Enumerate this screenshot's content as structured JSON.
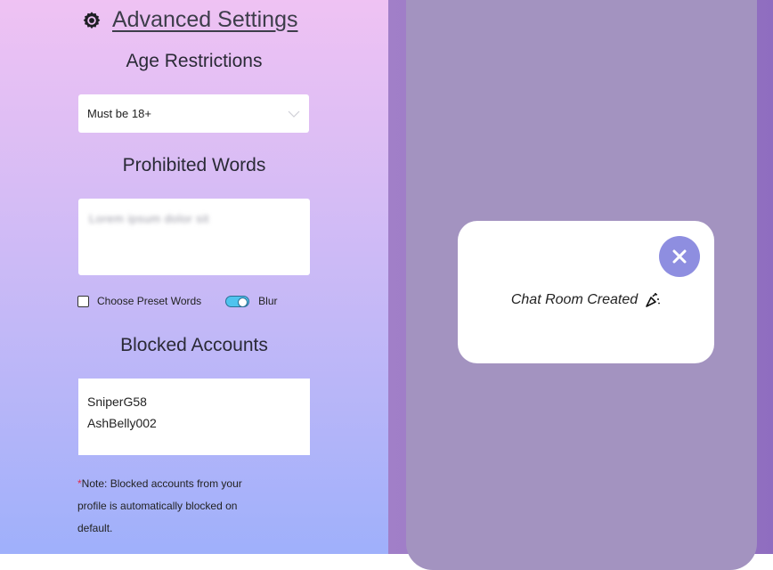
{
  "header": {
    "title": "Advanced Settings",
    "icon": "gear-icon"
  },
  "age": {
    "heading": "Age Restrictions",
    "selected": "Must be 18+"
  },
  "prohibited": {
    "heading": "Prohibited Words",
    "placeholder": "Lorem ipsum dolor sit",
    "preset_label": "Choose Preset Words",
    "blur_label": "Blur",
    "preset_checked": false,
    "blur_on": true
  },
  "blocked": {
    "heading": "Blocked Accounts",
    "accounts": [
      "SniperG58",
      "AshBelly002"
    ],
    "note_star": "*",
    "note": "Note: Blocked accounts from your profile is automatically blocked on default."
  },
  "modal": {
    "message": "Chat Room Created",
    "icon": "party-popper-icon"
  },
  "colors": {
    "accent_toggle": "#4fc3ee",
    "close_button": "#8e8ee0",
    "note_star": "#e02b4c"
  }
}
